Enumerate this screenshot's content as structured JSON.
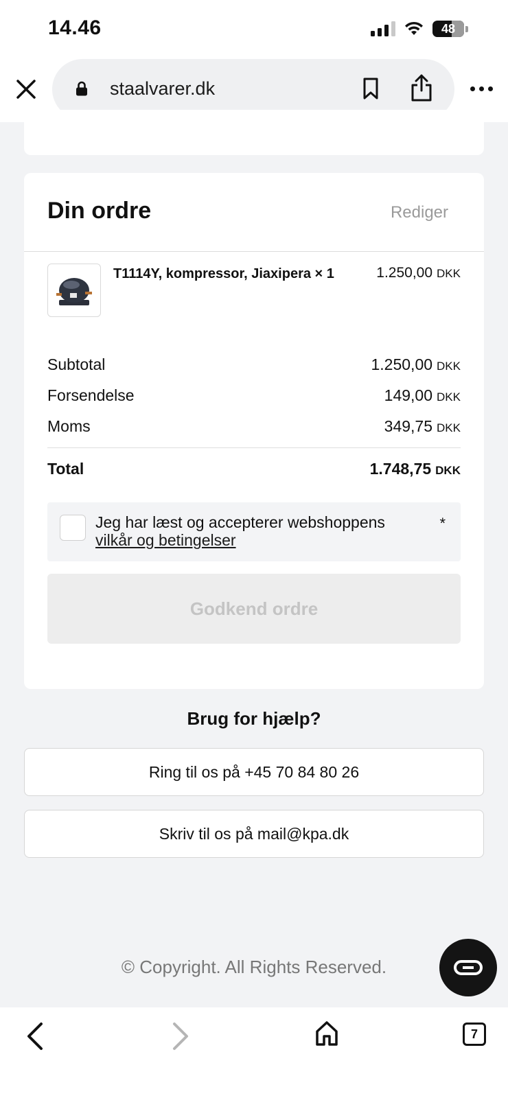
{
  "status_bar": {
    "time": "14.46",
    "battery": "48"
  },
  "browser": {
    "url": "staalvarer.dk"
  },
  "order": {
    "title": "Din ordre",
    "edit_label": "Rediger",
    "product": {
      "name": "T1114Y, kompressor, Jiaxipera × 1",
      "price": "1.250,00",
      "currency": "DKK"
    },
    "summary": {
      "subtotal_label": "Subtotal",
      "subtotal_value": "1.250,00",
      "shipping_label": "Forsendelse",
      "shipping_value": "149,00",
      "tax_label": "Moms",
      "tax_value": "349,75",
      "total_label": "Total",
      "total_value": "1.748,75",
      "currency": "DKK"
    },
    "terms": {
      "text": "Jeg har læst og accepterer webshoppens",
      "link": "vilkår og betingelser",
      "required_mark": "*",
      "checked": false
    },
    "approve_label": "Godkend ordre"
  },
  "help": {
    "title": "Brug for hjælp?",
    "phone_label": "Ring til os på +45 70 84 80 26",
    "mail_label": "Skriv til os på mail@kpa.dk"
  },
  "footer": {
    "copyright": "© Copyright. All Rights Reserved."
  },
  "bottom_nav": {
    "tab_count": "7"
  }
}
